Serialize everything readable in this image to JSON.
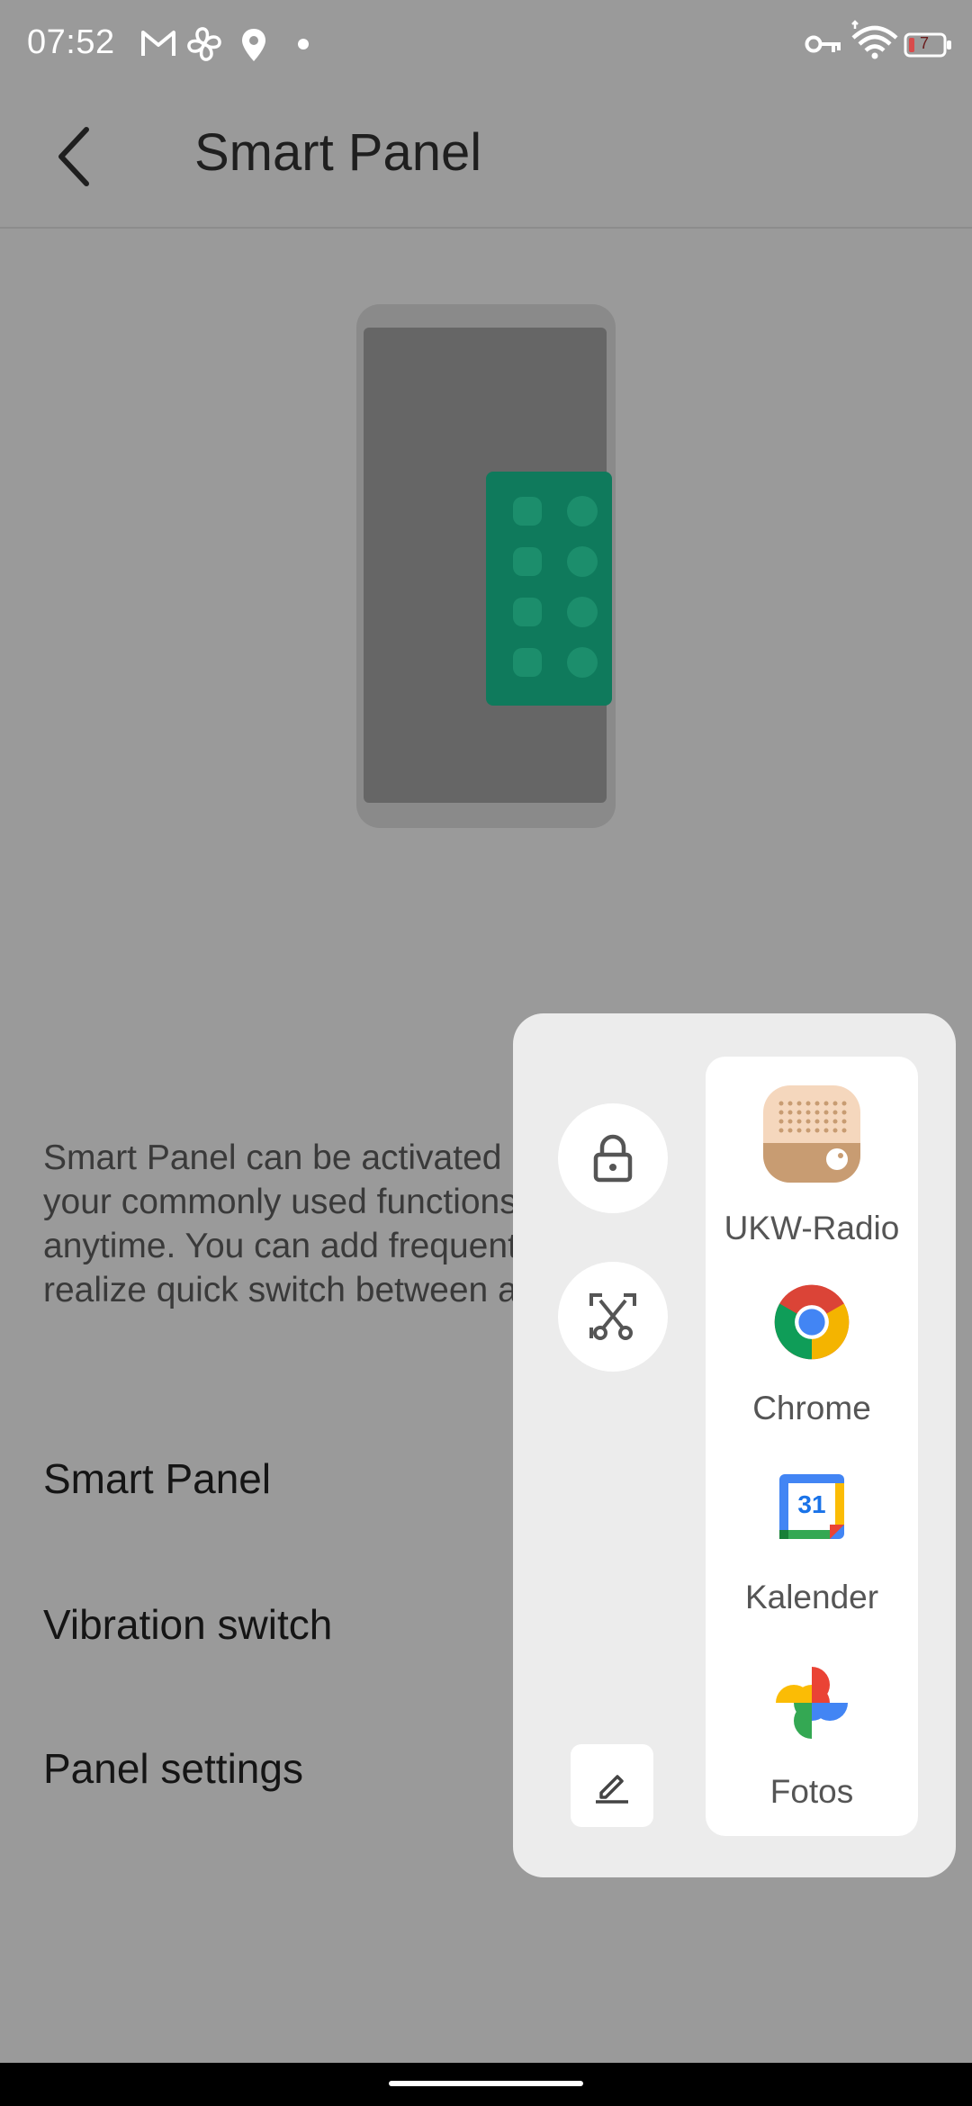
{
  "status_bar": {
    "time": "07:52",
    "battery_level": "7",
    "icons": [
      "gmail-icon",
      "fan-icon",
      "location-icon",
      "dot-icon",
      "vpn-key-icon",
      "wifi-icon",
      "battery-low-icon"
    ]
  },
  "app_bar": {
    "title": "Smart Panel"
  },
  "description": "Smart Panel can be activated in content. You can find your commonly used functions in it with only one step anytime. You can add frequently used apps on it to realize quick switch between apps.",
  "settings": {
    "smart_panel": "Smart Panel",
    "vibration_switch": "Vibration switch",
    "panel_settings": "Panel settings"
  },
  "panel": {
    "tools": [
      "lock-icon",
      "screenshot-scissors-icon"
    ],
    "apps": [
      {
        "label": "UKW-Radio",
        "icon": "radio-icon"
      },
      {
        "label": "Chrome",
        "icon": "chrome-icon"
      },
      {
        "label": "Kalender",
        "icon": "calendar-icon",
        "badge": "31"
      },
      {
        "label": "Fotos",
        "icon": "photos-icon"
      }
    ]
  },
  "colors": {
    "scrim": "#9a9a9a",
    "panel_bg": "#ececec",
    "illustration_accent": "#0f7a5c"
  }
}
